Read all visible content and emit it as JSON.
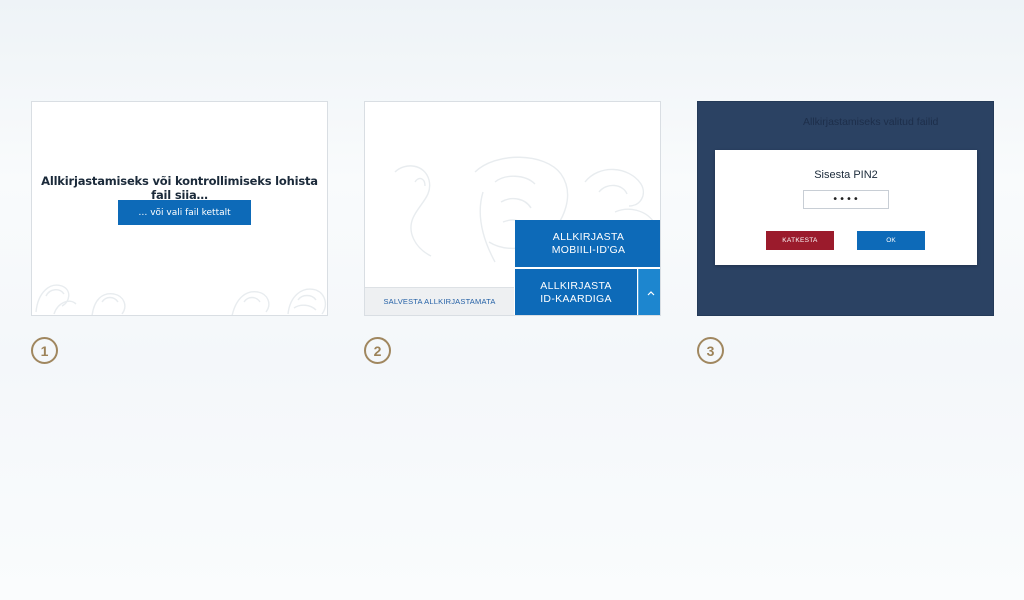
{
  "panels": [
    {
      "drop_text": "Allkirjastamiseks või kontrollimiseks lohista fail siia…",
      "choose_file_label": "… või vali fail kettalt"
    },
    {
      "save_unsigned_label": "SALVESTA ALLKIRJASTAMATA",
      "sign_mobile_line1": "ALLKIRJASTA",
      "sign_mobile_line2": "MOBIILI-ID'GA",
      "sign_idcard_line1": "ALLKIRJASTA",
      "sign_idcard_line2": "ID-KAARDIGA",
      "chevron_icon": "chevron-up-icon"
    },
    {
      "title": "Allkirjastamiseks valitud failid",
      "dialog_title": "Sisesta PIN2",
      "pin_value": "1234",
      "cancel_label": "KATKESTA",
      "ok_label": "OK"
    }
  ],
  "steps": [
    "1",
    "2",
    "3"
  ],
  "colors": {
    "primary_blue": "#0d6ab8",
    "chevron_blue": "#1d86cf",
    "cancel_red": "#9b1b2c",
    "dark_navy": "#2b4263",
    "step_gold": "#a0875f"
  }
}
